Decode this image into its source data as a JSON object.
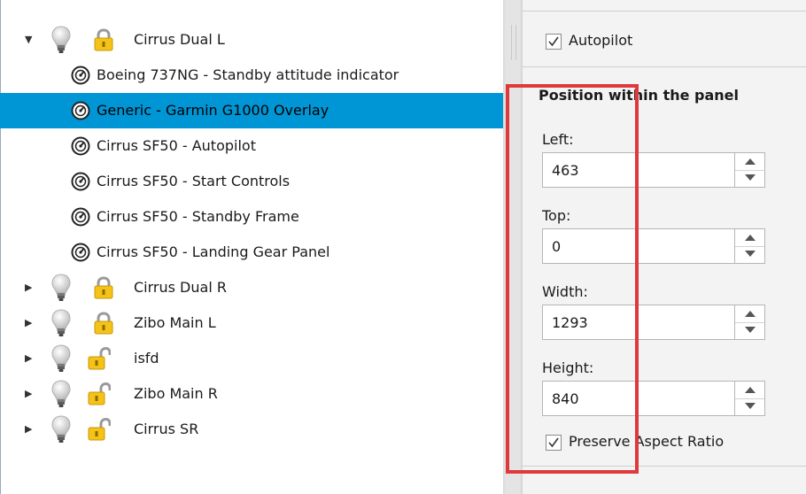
{
  "tree": {
    "groups_top": [
      {
        "label": "Cirrus Dual L",
        "expanded": true,
        "locked": true
      }
    ],
    "children": [
      {
        "label": "Boeing 737NG - Standby attitude indicator",
        "selected": false
      },
      {
        "label": "Generic - Garmin G1000 Overlay",
        "selected": true
      },
      {
        "label": "Cirrus SF50 - Autopilot",
        "selected": false
      },
      {
        "label": "Cirrus SF50 - Start Controls",
        "selected": false
      },
      {
        "label": "Cirrus SF50 - Standby Frame",
        "selected": false
      },
      {
        "label": "Cirrus SF50 - Landing Gear Panel",
        "selected": false
      }
    ],
    "groups_bottom": [
      {
        "label": "Cirrus Dual R",
        "locked": true
      },
      {
        "label": "Zibo Main L",
        "locked": true
      },
      {
        "label": "isfd",
        "locked": false
      },
      {
        "label": "Zibo Main R",
        "locked": false
      },
      {
        "label": "Cirrus SR",
        "locked": false
      }
    ]
  },
  "props": {
    "autopilot": {
      "label": "Autopilot",
      "checked": true
    },
    "section_title": "Position within the panel",
    "fields": {
      "left": {
        "label": "Left:",
        "value": "463"
      },
      "top": {
        "label": "Top:",
        "value": "0"
      },
      "width": {
        "label": "Width:",
        "value": "1293"
      },
      "height": {
        "label": "Height:",
        "value": "840"
      }
    },
    "preserve": {
      "label": "Preserve Aspect Ratio",
      "checked": true
    }
  },
  "colors": {
    "selection": "#0096d6",
    "highlight": "#e0393b",
    "lock_gold": "#f5c218"
  },
  "icons": {
    "group_visibility": "lightbulb-icon",
    "group_lock": "padlock-icon",
    "instrument": "gauge-icon",
    "expand": "triangle-right-icon",
    "collapse": "triangle-down-icon"
  }
}
